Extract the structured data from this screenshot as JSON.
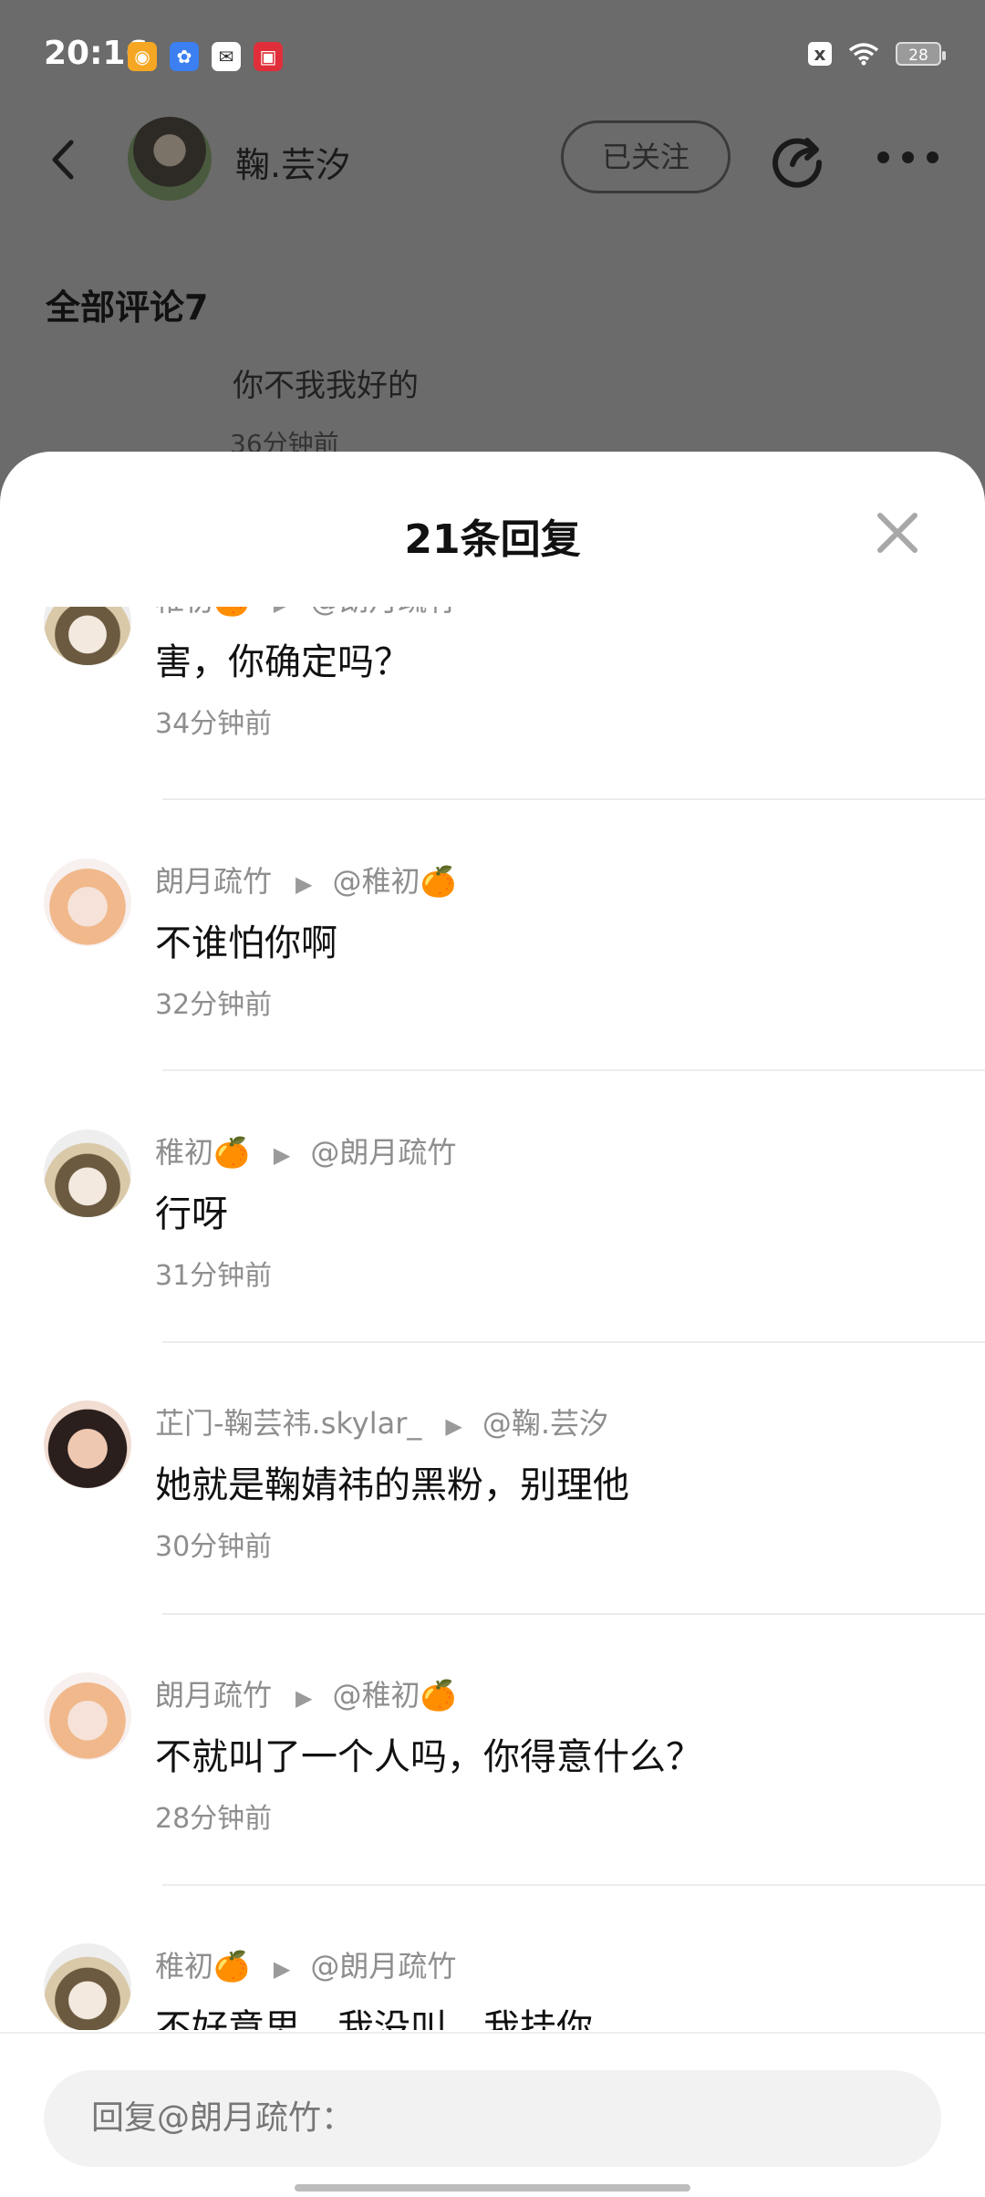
{
  "status_bar": {
    "time": "20:16",
    "battery": "28",
    "sim_icon": "x",
    "app_icons": [
      "weibo-icon",
      "baidu-icon",
      "mail-icon",
      "camera-icon"
    ]
  },
  "header": {
    "author_name": "鞠.芸汐",
    "follow_label": "已关注"
  },
  "background": {
    "all_comments_label": "全部评论7",
    "ghost_comment_text": "你不我我好的",
    "ghost_comment_time": "36分钟前"
  },
  "sheet": {
    "title": "21条回复"
  },
  "replies": [
    {
      "user": "稚初🍊",
      "target": "@朗月疏竹",
      "content": "害，你确定吗？",
      "time": "34分钟前",
      "avatar": "hat"
    },
    {
      "user": "朗月疏竹",
      "target": "@稚初🍊",
      "content": "不谁怕你啊",
      "time": "32分钟前",
      "avatar": "girl"
    },
    {
      "user": "稚初🍊",
      "target": "@朗月疏竹",
      "content": "行呀",
      "time": "31分钟前",
      "avatar": "hat"
    },
    {
      "user": "芷门-鞠芸祎.skylar_",
      "target": "@鞠.芸汐",
      "content": "她就是鞠婧祎的黑粉，别理他",
      "time": "30分钟前",
      "avatar": "dark"
    },
    {
      "user": "朗月疏竹",
      "target": "@稚初🍊",
      "content": "不就叫了一个人吗，你得意什么？",
      "time": "28分钟前",
      "avatar": "girl"
    },
    {
      "user": "稚初🍊",
      "target": "@朗月疏竹",
      "content": "不好意思，我没叫，我挂你",
      "time": "",
      "avatar": "hat"
    }
  ],
  "input": {
    "placeholder": "回复@朗月疏竹："
  }
}
